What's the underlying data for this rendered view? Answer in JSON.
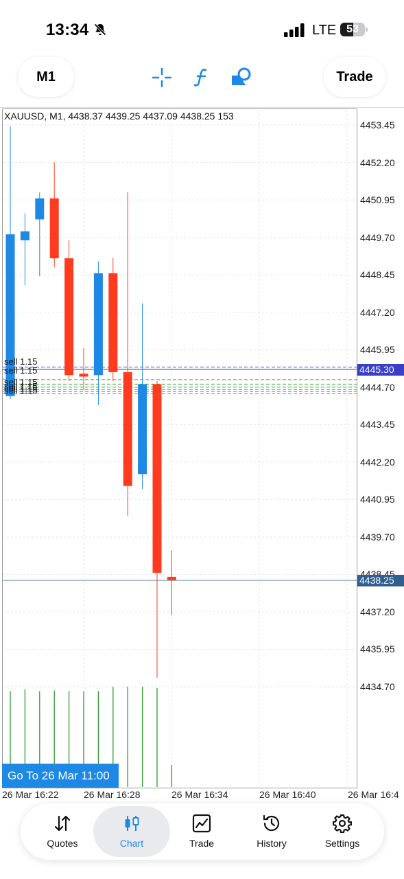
{
  "status_bar": {
    "time": "13:34",
    "network": "LTE",
    "battery": "53",
    "battery_level": 0.53
  },
  "toolbar": {
    "timeframe": "M1",
    "trade_button": "Trade",
    "icons": [
      "crosshair-icon",
      "function-icon",
      "shapes-icon"
    ]
  },
  "chart": {
    "header": "XAUUSD, M1, 4438.37 4439.25 4437.09 4438.25 153",
    "price_labels": [
      "4453.45",
      "4452.20",
      "4450.95",
      "4449.70",
      "4448.45",
      "4447.20",
      "4445.95",
      "4444.70",
      "4443.45",
      "4442.20",
      "4440.95",
      "4439.70",
      "4438.45",
      "4437.20",
      "4435.95",
      "4434.70"
    ],
    "current_price": "4438.25",
    "order_price": "4445.30",
    "time_labels": [
      "26 Mar 16:22",
      "26 Mar 16:28",
      "26 Mar 16:34",
      "26 Mar 16:40",
      "26 Mar 16:4"
    ],
    "order_labels": [
      "sell 1.15",
      "sell 1.15",
      "sell 1.15",
      "sell 1.15",
      "sell 1.15",
      "sell 1.15"
    ],
    "goto_button": "Go To 26 Mar 11:00",
    "colors": {
      "bull": "#1e88e5",
      "bear": "#ff3b1f",
      "volume": "#2e9a2e",
      "order_line": "#3a3fc7",
      "current_tag": "#2f5e8f",
      "order_tag": "#3a3fc7"
    }
  },
  "chart_data": {
    "type": "candlestick",
    "symbol": "XAUUSD",
    "timeframe": "M1",
    "ylim": [
      4433.7,
      4453.9
    ],
    "candles": [
      {
        "open": 4444.4,
        "high": 4453.4,
        "low": 4444.3,
        "close": 4449.8
      },
      {
        "open": 4449.6,
        "high": 4450.5,
        "low": 4448.1,
        "close": 4449.9
      },
      {
        "open": 4450.3,
        "high": 4451.2,
        "low": 4448.4,
        "close": 4451.0
      },
      {
        "open": 4451.0,
        "high": 4452.2,
        "low": 4448.7,
        "close": 4449.0
      },
      {
        "open": 4449.0,
        "high": 4449.6,
        "low": 4444.9,
        "close": 4445.1
      },
      {
        "open": 4445.15,
        "high": 4446.0,
        "low": 4444.6,
        "close": 4445.05
      },
      {
        "open": 4445.1,
        "high": 4448.9,
        "low": 4444.1,
        "close": 4448.5
      },
      {
        "open": 4448.5,
        "high": 4449.0,
        "low": 4444.9,
        "close": 4445.2
      },
      {
        "open": 4445.2,
        "high": 4451.2,
        "low": 4440.4,
        "close": 4441.4
      },
      {
        "open": 4441.8,
        "high": 4447.5,
        "low": 4441.3,
        "close": 4444.8
      },
      {
        "open": 4444.8,
        "high": 4444.9,
        "low": 4435.0,
        "close": 4438.5
      },
      {
        "open": 4438.37,
        "high": 4439.25,
        "low": 4437.09,
        "close": 4438.25
      }
    ],
    "volumes": [
      153,
      156,
      153,
      154,
      153,
      153,
      153,
      160,
      160,
      160,
      158,
      35
    ],
    "volume_max": 160
  }
}
